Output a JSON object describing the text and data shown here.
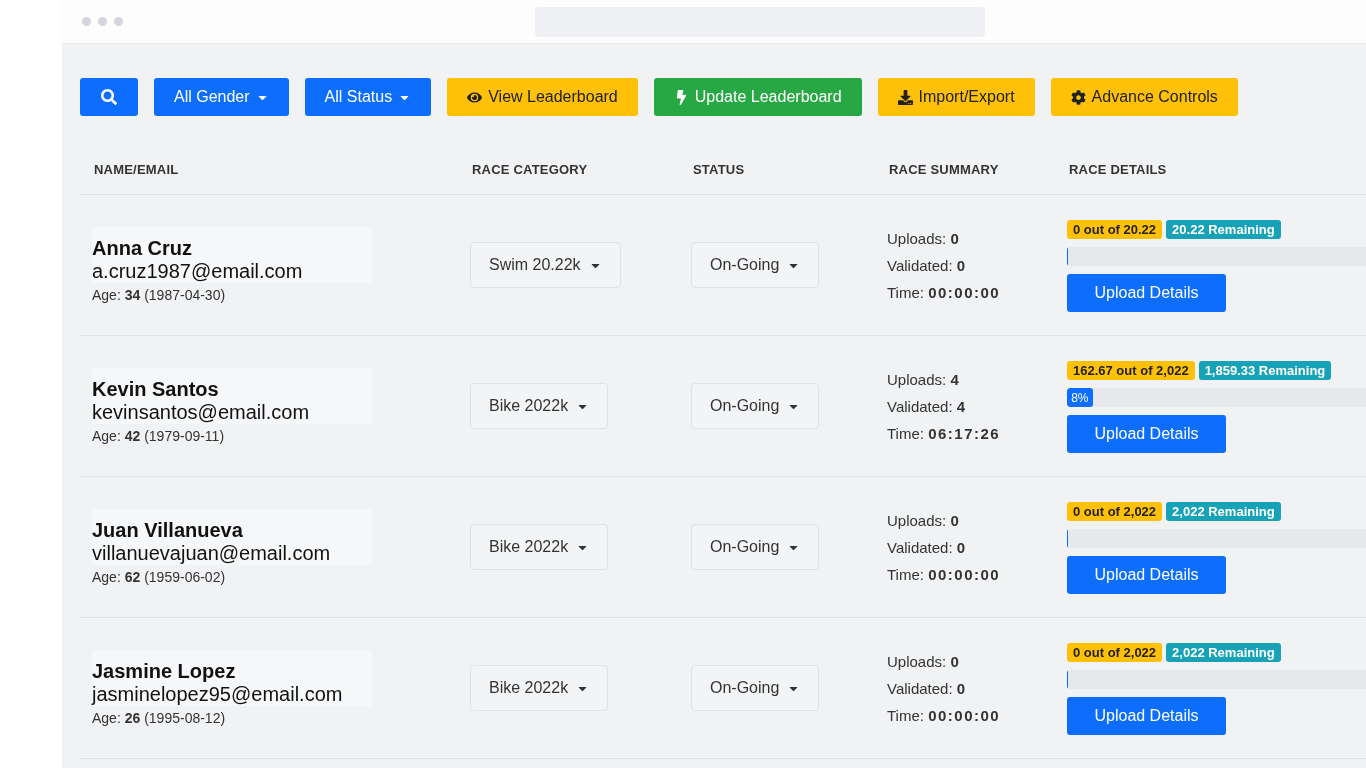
{
  "toolbar": {
    "filters": [
      {
        "label": "All Gender"
      },
      {
        "label": "All Status"
      }
    ],
    "actions": [
      {
        "kind": "view",
        "label": "View Leaderboard"
      },
      {
        "kind": "update",
        "label": "Update Leaderboard"
      },
      {
        "kind": "import",
        "label": "Import/Export"
      },
      {
        "kind": "advanced",
        "label": "Advance Controls"
      }
    ]
  },
  "table": {
    "columns": [
      "NAME/EMAIL",
      "RACE CATEGORY",
      "STATUS",
      "RACE SUMMARY",
      "RACE DETAILS"
    ],
    "rows": [
      {
        "name": "Anna Cruz",
        "email": "a.cruz1987@email.com",
        "age": "Age: **34** (1987-04-30)",
        "category": "Swim 20.22k",
        "status": "On-Going",
        "uploads": "Uploads: **0**",
        "validated": "Validated: **0**",
        "time": "Time: **00:00:00**",
        "progress": "0 out of 20.22",
        "remaining": "20.22 Remaining",
        "level": 0,
        "button": "Upload Details"
      },
      {
        "name": "Kevin Santos",
        "email": "kevinsantos@email.com",
        "age": "Age: **42** (1979-09-11)",
        "category": "Bike 2022k",
        "status": "On-Going",
        "uploads": "Uploads: **4**",
        "validated": "Validated: **4**",
        "time": "Time: **06:17:26**",
        "progress": "162.67 out of 2,022",
        "remaining": "1,859.33 Remaining",
        "level": 0.08,
        "percent": "8%",
        "button": "Upload Details"
      },
      {
        "name": "Juan Villanueva",
        "email": "villanuevajuan@email.com",
        "age": "Age: **62** (1959-06-02)",
        "category": "Bike 2022k",
        "status": "On-Going",
        "uploads": "Uploads: **0**",
        "validated": "Validated: **0**",
        "time": "Time: **00:00:00**",
        "progress": "0 out of 2,022",
        "remaining": "2,022 Remaining",
        "level": 0,
        "button": "Upload Details"
      },
      {
        "name": "Jasmine Lopez",
        "email": "jasminelopez95@email.com",
        "age": "Age: **26** (1995-08-12)",
        "category": "Bike 2022k",
        "status": "On-Going",
        "uploads": "Uploads: **0**",
        "validated": "Validated: **0**",
        "time": "Time: **00:00:00**",
        "progress": "0 out of 2,022",
        "remaining": "2,022 Remaining",
        "level": 0,
        "button": "Upload Details"
      }
    ]
  }
}
